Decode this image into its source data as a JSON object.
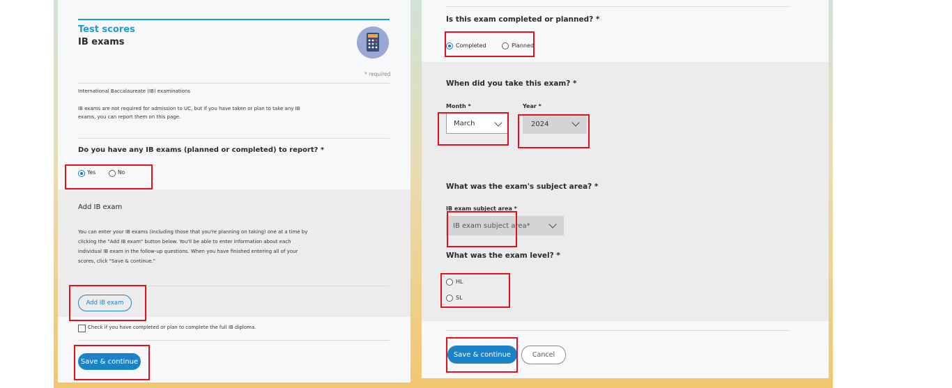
{
  "left": {
    "section": "Test scores",
    "title": "IB exams",
    "required_note": "* required",
    "intro_title": "International Baccalaureate (IB) examinations",
    "intro_line1": "IB exams are not required for admission to UC, but if you have taken or plan to take any IB",
    "intro_line2": "exams, you can report them on this page.",
    "question": "Do you have any IB exams (planned or completed) to report? *",
    "option_yes": "Yes",
    "option_no": "No",
    "add_heading": "Add IB exam",
    "add_line1": "You can enter your IB exams (including those that you're planning on taking) one at a time by",
    "add_line2": "clicking the \"Add IB exam\" button below. You'll be able to enter information about each",
    "add_line3": "individual IB exam in the follow-up questions. When you have finished entering all of your",
    "add_line4": "scores, click \"Save & continue.\"",
    "add_button": "Add IB exam",
    "diploma_check": "Check if you have completed or plan to complete the full IB diploma.",
    "save_button": "Save & continue"
  },
  "right": {
    "status_question": "Is this exam completed or planned? *",
    "status_completed": "Completed",
    "status_planned": "Planned",
    "date_question": "When did you take this exam? *",
    "month_label": "Month *",
    "month_value": "March",
    "year_label": "Year *",
    "year_value": "2024",
    "subject_question": "What was the exam's subject area? *",
    "subject_label": "IB exam subject area *",
    "subject_placeholder": "IB exam subject area*",
    "level_question": "What was the exam level? *",
    "level_hl": "HL",
    "level_sl": "SL",
    "save_button": "Save & continue",
    "cancel_button": "Cancel"
  },
  "colors": {
    "accent_blue": "#1b82c8",
    "section_blue": "#1a9ad6",
    "highlight_red": "#e2111a"
  }
}
